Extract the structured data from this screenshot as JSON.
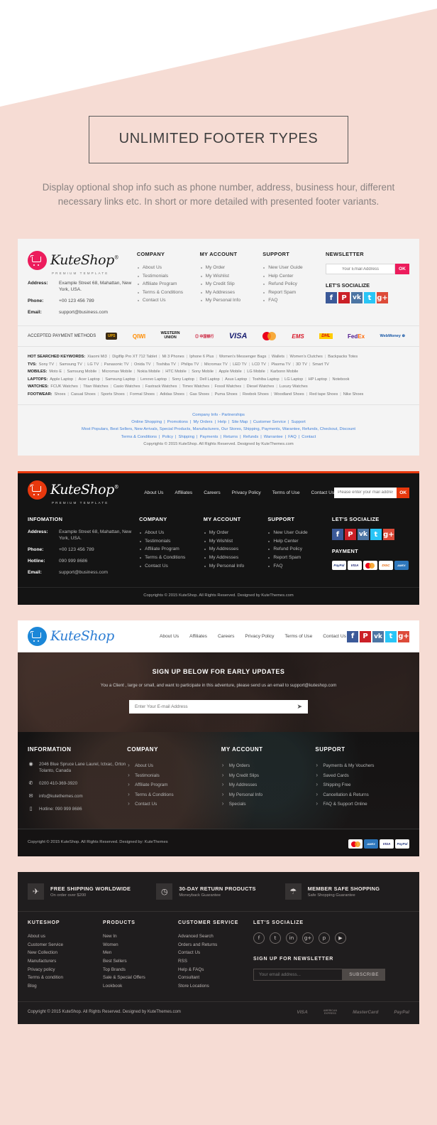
{
  "hero": {
    "title": "UNLIMITED FOOTER TYPES",
    "subtitle": "Display optional shop info such as phone number, address, business hour, different necessary links etc. In short or more detailed with presented footer variants."
  },
  "brand": {
    "name": "KuteShop",
    "reg": "®",
    "tagline": "PREMIUM TEMPLATE"
  },
  "footer1": {
    "info": {
      "address_label": "Address:",
      "address_value": "Example Street 68, Mahattan, New York, USA.",
      "phone_label": "Phone:",
      "phone_value": "+00 123 456 789",
      "email_label": "Email:",
      "email_value": "support@business.com"
    },
    "company": {
      "head": "COMPANY",
      "items": [
        "About Us",
        "Testimonials",
        "Affiliate Program",
        "Terms & Conditions",
        "Contact Us"
      ]
    },
    "account": {
      "head": "MY ACCOUNT",
      "items": [
        "My Order",
        "My Wishlist",
        "My Credit Slip",
        "My Addresses",
        "My Personal Info"
      ]
    },
    "support": {
      "head": "SUPPORT",
      "items": [
        "New User Guide",
        "Help Center",
        "Refund Policy",
        "Report Spam",
        "FAQ"
      ]
    },
    "newsletter": {
      "head": "NEWSLETTER",
      "placeholder": "Your Email Address",
      "button": "OK"
    },
    "socialize": {
      "head": "LET'S SOCIALIZE",
      "icons": [
        "facebook-icon",
        "pinterest-icon",
        "vk-icon",
        "twitter-icon",
        "googleplus-icon"
      ]
    },
    "payments": {
      "label": "ACCEPTED PAYMENT METHODS",
      "logos": [
        "UPS Preferred Carrier",
        "QIWI",
        "WESTERN UNION",
        "Bank of China",
        "VISA",
        "MasterCard",
        "EMS",
        "DHL",
        "FedEx Express",
        "WebMoney"
      ]
    },
    "keywords": [
      {
        "key": "HOT SEARCHED KEYWORDS:",
        "items": [
          "Xiaomi Mi3",
          "Digiflip Pro XT 712 Tablet",
          "Mi 3 Phones",
          "Iphone 6 Plus",
          "Women's Messenger Bags",
          "Wallets",
          "Women's Clutches",
          "Backpacks Totes"
        ]
      },
      {
        "key": "TVS:",
        "items": [
          "Sony TV",
          "Samsung TV",
          "LG TV",
          "Panasonic TV",
          "Onida TV",
          "Toshiba TV",
          "Philips TV",
          "Micromax TV",
          "LED TV",
          "LCD TV",
          "Plasma TV",
          "3D TV",
          "Smart TV"
        ]
      },
      {
        "key": "MOBILES:",
        "items": [
          "Moto E",
          "Samsung Mobile",
          "Micromax Mobile",
          "Nokia Mobile",
          "HTC Mobile",
          "Sony Mobile",
          "Apple Mobile",
          "LG Mobile",
          "Karbonn Mobile"
        ]
      },
      {
        "key": "LAPTOPS:",
        "items": [
          "Apple Laptop",
          "Acer Laptop",
          "Samsung Laptop",
          "Lenovo Laptop",
          "Sony Laptop",
          "Dell Laptop",
          "Asus Laptop",
          "Toshiba Laptop",
          "LG Laptop",
          "HP Laptop",
          "Notebook"
        ]
      },
      {
        "key": "WATCHES:",
        "items": [
          "FCUK Watches",
          "Titan Watches",
          "Casio Watches",
          "Fastrack Watches",
          "Timex Watches",
          "Fossil Watches",
          "Diesel Watches",
          "Luxury Watches"
        ]
      },
      {
        "key": "FOOTWEAR:",
        "items": [
          "Shoes",
          "Casual Shoes",
          "Sports Shoes",
          "Formal Shoes",
          "Adidas Shoes",
          "Gas Shoes",
          "Puma Shoes",
          "Reebok Shoes",
          "Woodland Shoes",
          "Red tape Shoes",
          "Nike Shoes"
        ]
      }
    ],
    "bottom_rows": [
      [
        "Company Info - Partnerships"
      ],
      [
        "Online Shopping",
        "Promotions",
        "My Orders",
        "Help",
        "Site Map",
        "Customer Service",
        "Support"
      ],
      [
        "Most Populars, Best Sellers, New Arrivals, Special Products, Manufacturers, Our Stores, Shipping, Payments, Warantee, Refunds, Checkout, Discount"
      ],
      [
        "Terms & Conditions",
        "Policy",
        "Shipping",
        "Payments",
        "Returns",
        "Refunds",
        "Warrantee",
        "FAQ",
        "Contact"
      ]
    ],
    "copyright": "Copyrights © 2015 KuteShop. All Rights Reserved. Designed by KuteThemes.com"
  },
  "footer2": {
    "nav": [
      "About Us",
      "Affiliates",
      "Careers",
      "Privacy Policy",
      "Terms of Use",
      "Contact Us"
    ],
    "newsletter": {
      "placeholder": "Please enter your mail address",
      "button": "OK"
    },
    "info": {
      "head": "INFOMATION",
      "address_label": "Address:",
      "address_value": "Example Street 68, Mahattan, New York, USA.",
      "phone_label": "Phone:",
      "phone_value": "+00 123 456 789",
      "hotline_label": "Hotline:",
      "hotline_value": "090 999 8686",
      "email_label": "Email:",
      "email_value": "support@business.com"
    },
    "company": {
      "head": "COMPANY",
      "items": [
        "About Us",
        "Testimonials",
        "Affiliate Program",
        "Terms & Conditions",
        "Contact Us"
      ]
    },
    "account": {
      "head": "MY ACCOUNT",
      "items": [
        "My Order",
        "My Wishlist",
        "My Addresses",
        "My Addresses",
        "My Personal Info"
      ]
    },
    "support": {
      "head": "SUPPORT",
      "items": [
        "New User Guide",
        "Help Center",
        "Refund Policy",
        "Report Spam",
        "FAQ"
      ]
    },
    "socialize": {
      "head": "LET'S SOCIALIZE",
      "icons": [
        "facebook-icon",
        "pinterest-icon",
        "vk-icon",
        "twitter-icon",
        "googleplus-icon"
      ]
    },
    "payment": {
      "head": "PAYMENT",
      "logos": [
        "PayPal",
        "VISA",
        "MasterCard",
        "DISCOVER",
        "AMEX"
      ]
    },
    "copyright": "Copyrights © 2015 KuteShop. All Rights Reserved. Designed by KuteThemes.com"
  },
  "footer3": {
    "nav": [
      "About Us",
      "Affiliates",
      "Careers",
      "Privacy Policy",
      "Terms of Use",
      "Contact Us"
    ],
    "socialize_icons": [
      "facebook-icon",
      "pinterest-icon",
      "vk-icon",
      "twitter-icon",
      "googleplus-icon"
    ],
    "hero": {
      "title": "SIGN UP BELOW FOR EARLY UPDATES",
      "subtitle": "You a Client , large or small, and want to participate in this adventure, please send us an email to support@kuteshop.com",
      "placeholder": "Enter Your E-mail Address",
      "send_icon": "send-icon"
    },
    "information": {
      "head": "INFORMATION",
      "address": "2046 Blue Spruce Lane Laurel, Ictxac, Orton Tolanto, Canada",
      "phone": "0200 410-369-3920",
      "email": "info@kutethemes.com",
      "hotline": "Hotline: 090 999 8686"
    },
    "company": {
      "head": "COMPANY",
      "items": [
        "About Us",
        "Testimonials",
        "Affiliate Program",
        "Terms & Conditions",
        "Contact Us"
      ]
    },
    "account": {
      "head": "MY ACCOUNT",
      "items": [
        "My Orders",
        "My Credit Slips",
        "My Addresses",
        "My Personal Info",
        "Specials"
      ]
    },
    "support": {
      "head": "SUPPORT",
      "items": [
        "Payments & My Vouchers",
        "Saved Cards",
        "Shipping Free",
        "Cancellation & Returns",
        "FAQ & Support Online"
      ]
    },
    "copyright": "Copyright © 2015 KuteShop. All Rights Reserved. Designed by: KuteThemes",
    "payments": [
      "MasterCard",
      "AMEX",
      "VISA",
      "PayPal"
    ]
  },
  "footer4": {
    "services": [
      {
        "icon": "airplane-icon",
        "title": "FREE SHIPPING WORLDWIDE",
        "sub": "On order over $200"
      },
      {
        "icon": "clock-icon",
        "title": "30-DAY RETURN PRODUCTS",
        "sub": "Moneyback Guarantee"
      },
      {
        "icon": "umbrella-icon",
        "title": "MEMBER SAFE SHOPPING",
        "sub": "Safe Shopping Guarantee"
      }
    ],
    "kuteshop": {
      "head": "KUTESHOP",
      "items": [
        "About us",
        "Customer Service",
        "New Collection",
        "Manufacturers",
        "Privacy policy",
        "Terms & condition",
        "Blog"
      ]
    },
    "products": {
      "head": "PRODUCTS",
      "items": [
        "New In",
        "Women",
        "Men",
        "Best Sellers",
        "Top Brands",
        "Sale & Special Offers",
        "Lookbook"
      ]
    },
    "customer_service": {
      "head": "CUSTOMER SERVICE",
      "items": [
        "Advanced Search",
        "Orders and Returns",
        "Contact Us",
        "RSS",
        "Help & FAQs",
        "Consultant",
        "Store Locations"
      ]
    },
    "socialize": {
      "head": "LET'S SOCIALIZE",
      "icons": [
        "facebook-icon",
        "twitter-icon",
        "linkedin-icon",
        "googleplus-icon",
        "pinterest-icon",
        "youtube-icon"
      ]
    },
    "newsletter": {
      "head": "SIGN UP FOR NEWSLETTER",
      "placeholder": "Your email address...",
      "button": "SUBSCRIBE"
    },
    "copyright": "Copyright © 2015 KuteShop. All Rights Reserved. Designed by KuteThemes.com",
    "payments": [
      "VISA",
      "AMERICAN EXPRESS",
      "MasterCard",
      "PayPal"
    ]
  },
  "colors": {
    "page_bg": "#f6dcd4",
    "pink_accent": "#ec1c5c",
    "red_accent": "#e8380d",
    "blue_accent": "#1b87d8",
    "link_blue": "#3f7fd8"
  }
}
